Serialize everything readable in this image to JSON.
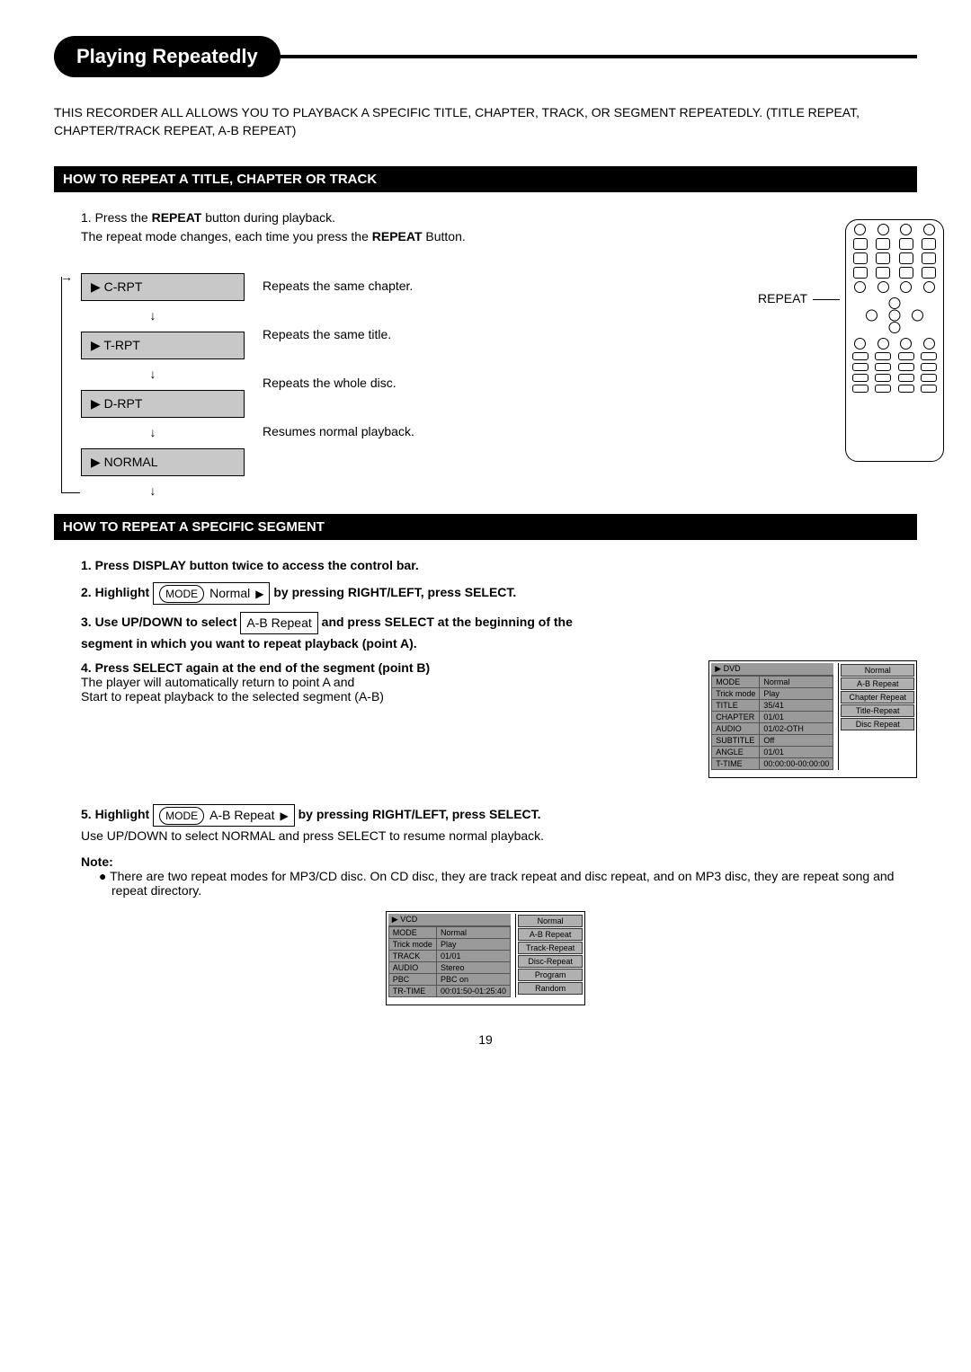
{
  "page_title": "Playing Repeatedly",
  "intro": "THIS RECORDER ALL ALLOWS YOU TO PLAYBACK A SPECIFIC TITLE, CHAPTER, TRACK, OR SEGMENT REPEATEDLY. (TITLE REPEAT, CHAPTER/TRACK REPEAT, A-B REPEAT)",
  "section1_title": "HOW TO REPEAT A TITLE, CHAPTER OR TRACK",
  "step1_prefix": "1. Press the ",
  "step1_bold": "REPEAT",
  "step1_suffix": " button during playback.",
  "step1_line2_prefix": "The repeat mode changes, each time you press the ",
  "step1_line2_bold": "REPEAT",
  "step1_line2_suffix": " Button.",
  "repeat_label": "REPEAT",
  "modes": [
    {
      "label": "▶ C-RPT",
      "desc": "Repeats the same chapter."
    },
    {
      "label": "▶ T-RPT",
      "desc": "Repeats the same title."
    },
    {
      "label": "▶ D-RPT",
      "desc": "Repeats the whole disc."
    },
    {
      "label": "▶ NORMAL",
      "desc": "Resumes normal playback."
    }
  ],
  "section2_title": "HOW TO REPEAT A SPECIFIC SEGMENT",
  "seg_step1": "1. Press DISPLAY button twice  to access the control bar.",
  "seg_step2_prefix": "2. Highlight",
  "seg_step2_box_mode": "MODE",
  "seg_step2_box_val": "Normal",
  "seg_step2_suffix": "by pressing RIGHT/LEFT, press SELECT.",
  "seg_step3_prefix": "3. Use UP/DOWN to select",
  "seg_step3_box": "A-B Repeat",
  "seg_step3_mid": "and press SELECT at the beginning of the",
  "seg_step3_line2": "segment in which you want to repeat playback (point A).",
  "seg_step4": "4. Press SELECT again at the end of the segment (point B)",
  "seg_step4_line2": "The player will automatically return to point A and",
  "seg_step4_line3": "Start to repeat playback to the selected segment (A-B)",
  "seg_step5_prefix": "5. Highlight",
  "seg_step5_box_mode": "MODE",
  "seg_step5_box_val": "A-B Repeat",
  "seg_step5_suffix": "by pressing RIGHT/LEFT, press SELECT.",
  "seg_step5_line2": "Use UP/DOWN to select NORMAL and press SELECT to resume normal playback.",
  "note_label": "Note:",
  "note_bullet": "There are two repeat modes for MP3/CD disc. On CD disc, they are track repeat and disc repeat, and on MP3 disc, they are repeat song and repeat directory.",
  "dvd_osd": {
    "title": "▶ DVD",
    "rows": [
      [
        "MODE",
        "Normal"
      ],
      [
        "Trick mode",
        "Play"
      ],
      [
        "TITLE",
        "35/41"
      ],
      [
        "CHAPTER",
        "01/01"
      ],
      [
        "AUDIO",
        "01/02-OTH"
      ],
      [
        "SUBTITLE",
        "Off"
      ],
      [
        "ANGLE",
        "01/01"
      ],
      [
        "T-TIME",
        "00:00:00-00:00:00"
      ]
    ],
    "menu": [
      "Normal",
      "A-B Repeat",
      "Chapter   Repeat",
      "Title-Repeat",
      "Disc Repeat"
    ]
  },
  "vcd_osd": {
    "title": "▶ VCD",
    "rows": [
      [
        "MODE",
        "Normal"
      ],
      [
        "Trick mode",
        "Play"
      ],
      [
        "TRACK",
        "01/01"
      ],
      [
        "AUDIO",
        "Stereo"
      ],
      [
        "PBC",
        "PBC on"
      ],
      [
        "TR-TIME",
        "00:01:50-01:25:40"
      ]
    ],
    "menu": [
      "Normal",
      "A-B Repeat",
      "Track-Repeat",
      "Disc-Repeat",
      "Program",
      "Random"
    ]
  },
  "page_number": "19"
}
